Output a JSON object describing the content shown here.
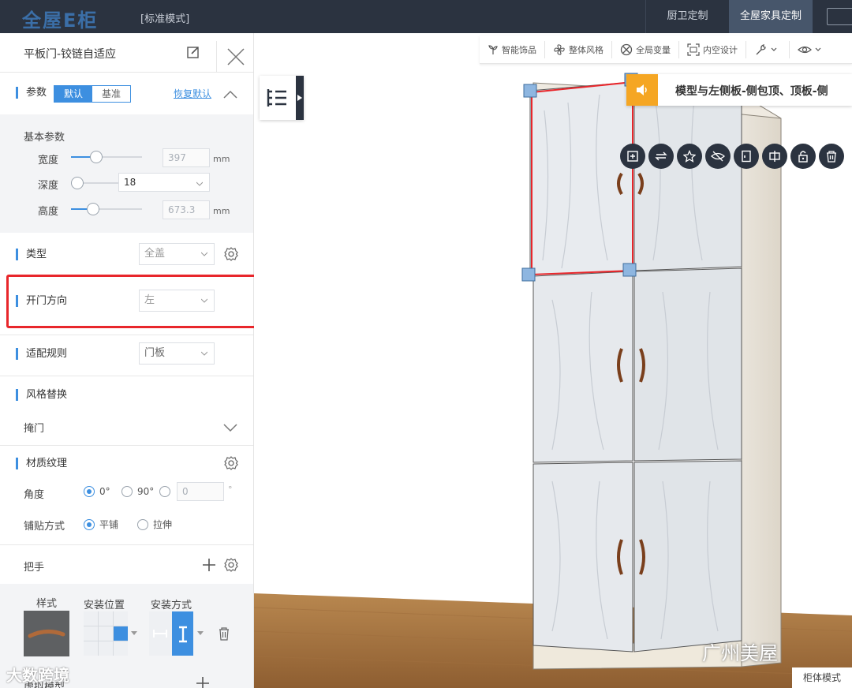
{
  "topbar": {
    "logo": "全屋E柜",
    "mode": "[标准模式]",
    "tabs": [
      {
        "label": "厨卫定制",
        "active": false
      },
      {
        "label": "全屋家具定制",
        "active": true
      }
    ]
  },
  "panel": {
    "title": "平板门-铰链自适应",
    "params": {
      "label": "参数",
      "seg_default": "默认",
      "seg_base": "基准",
      "restore": "恢复默认"
    },
    "basic": {
      "label": "基本参数",
      "width_label": "宽度",
      "width_value": "397",
      "depth_label": "深度",
      "depth_value": "18",
      "height_label": "高度",
      "height_value": "673.3",
      "unit": "mm"
    },
    "type": {
      "label": "类型",
      "value": "全盖"
    },
    "open_dir": {
      "label": "开门方向",
      "value": "左"
    },
    "fit_rule": {
      "label": "适配规则",
      "value": "门板"
    },
    "style_replace": {
      "label": "风格替换",
      "item": "掩门"
    },
    "material": {
      "label": "材质纹理",
      "angle_label": "角度",
      "angle_0": "0°",
      "angle_90": "90°",
      "angle_custom": "0",
      "degree": "°",
      "tile_label": "铺贴方式",
      "tile_flat": "平铺",
      "tile_stretch": "拉伸"
    },
    "handle": {
      "label": "把手",
      "style_label": "样式",
      "pos_label": "安装位置",
      "mount_label": "安装方式"
    },
    "next_section": "虚拟模型"
  },
  "toolbar": {
    "items": [
      "智能饰品",
      "整体风格",
      "全局变量",
      "内空设计"
    ]
  },
  "notice": "模型与左侧板-侧包顶、顶板-侧",
  "watermarks": {
    "left": "大数跨境",
    "right": "广州美屋"
  },
  "cabinet_mode": "柜体模式",
  "colors": {
    "accent": "#3d8fe0",
    "topbar": "#2b3340",
    "highlight": "#e8262b",
    "notice": "#f5a623"
  }
}
